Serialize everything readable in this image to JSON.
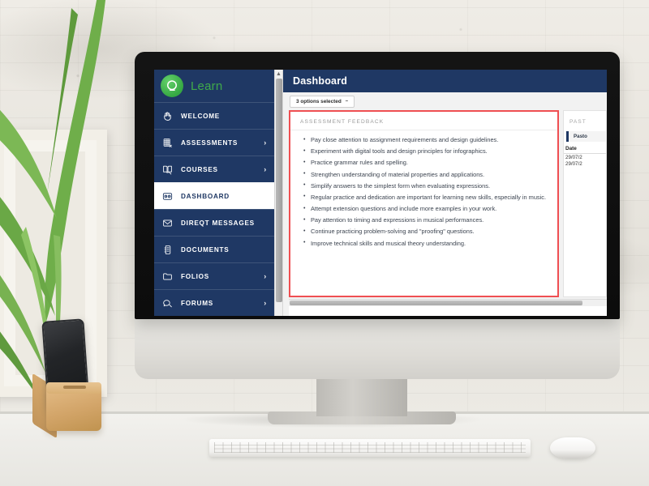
{
  "photo": {
    "scene_description": "iMac desktop computer on a white desk against a white painted brick wall, with a plant, a framed picture, a smartphone on a wooden stand, a keyboard and a mouse",
    "objects": [
      "wall",
      "plant",
      "picture-frame",
      "smartphone",
      "wooden-phone-stand",
      "imac-monitor",
      "keyboard",
      "mouse",
      "desk"
    ]
  },
  "app": {
    "brand": {
      "name": "Learn",
      "logo": "q-circle-logo",
      "logo_color": "#3faa4a"
    },
    "accent_navy": "#1f3864",
    "alert_red": "#ef4f52"
  },
  "sidebar": {
    "items": [
      {
        "label": "WELCOME",
        "icon": "hand-wave-icon",
        "chevron": "",
        "active": false
      },
      {
        "label": "ASSESSMENTS",
        "icon": "assessment-grid-icon",
        "chevron": "›",
        "active": false
      },
      {
        "label": "COURSES",
        "icon": "book-icon",
        "chevron": "›",
        "active": false
      },
      {
        "label": "DASHBOARD",
        "icon": "dashboard-gauge-icon",
        "chevron": "",
        "active": true
      },
      {
        "label": "DIREQT MESSAGES",
        "icon": "envelope-icon",
        "chevron": "",
        "active": false
      },
      {
        "label": "DOCUMENTS",
        "icon": "documents-icon",
        "chevron": "",
        "active": false
      },
      {
        "label": "FOLIOS",
        "icon": "folder-icon",
        "chevron": "›",
        "active": false
      },
      {
        "label": "FORUMS",
        "icon": "chat-bubble-icon",
        "chevron": "›",
        "active": false
      }
    ]
  },
  "header": {
    "title": "Dashboard"
  },
  "toolbar": {
    "dropdown_label": "3 options selected",
    "caret": "–"
  },
  "feedback_card": {
    "title": "ASSESSMENT FEEDBACK",
    "items": [
      "Pay close attention to assignment requirements and design guidelines.",
      "Experiment with digital tools and design principles for infographics.",
      "Practice grammar rules and spelling.",
      "Strengthen understanding of material properties and applications.",
      "Simplify answers to the simplest form when evaluating expressions.",
      "Regular practice and dedication are important for learning new skills, especially in music.",
      "Attempt extension questions and include more examples in your work.",
      "Pay attention to timing and expressions in musical performances.",
      "Continue practicing problem-solving and \"proofing\" questions.",
      "Improve technical skills and musical theory understanding."
    ]
  },
  "past_card": {
    "title": "PAST",
    "tab_label": "Pasto",
    "column_header": "Date",
    "rows": [
      "29/07/2",
      "29/07/2"
    ]
  }
}
